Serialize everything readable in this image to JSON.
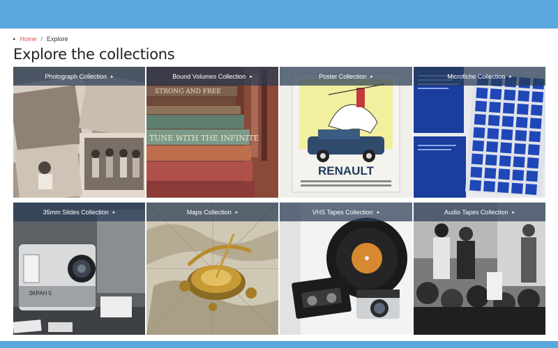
{
  "breadcrumb": {
    "home": "Home",
    "separator": "/",
    "current": "Explore"
  },
  "page_title": "Explore the collections",
  "colors": {
    "header": "#5aa7dd",
    "link": "#d9534f",
    "label_bg": "#283c55"
  },
  "tiles": [
    {
      "label": "Photograph Collection",
      "arrow": "▸"
    },
    {
      "label": "Bound Volumes Collection",
      "arrow": "▸"
    },
    {
      "label": "Poster Collection",
      "arrow": "▸",
      "poster_text": "RENAULT"
    },
    {
      "label": "Microfiche Collection",
      "arrow": "▸"
    },
    {
      "label": "35mm Slides Collection",
      "arrow": "▸",
      "slide_text": "ЭКРАН 5"
    },
    {
      "label": "Maps Collection",
      "arrow": "▸"
    },
    {
      "label": "VHS Tapes Collection",
      "arrow": "▸"
    },
    {
      "label": "Audio Tapes Collection",
      "arrow": "▸"
    }
  ]
}
